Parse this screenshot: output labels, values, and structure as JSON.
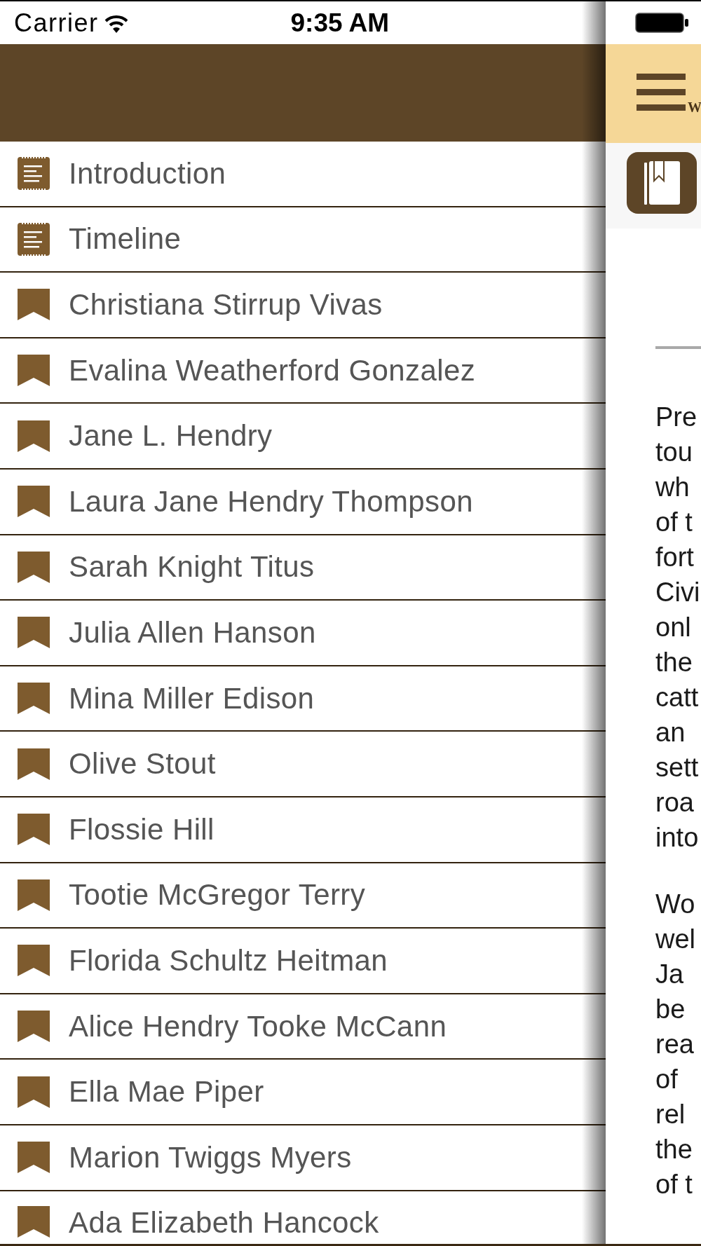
{
  "status_bar": {
    "carrier": "Carrier",
    "time": "9:35 AM"
  },
  "menu": {
    "items": [
      {
        "kind": "document",
        "label": "Introduction"
      },
      {
        "kind": "document",
        "label": "Timeline"
      },
      {
        "kind": "bookmark",
        "label": "Christiana Stirrup Vivas"
      },
      {
        "kind": "bookmark",
        "label": "Evalina Weatherford Gonzalez"
      },
      {
        "kind": "bookmark",
        "label": "Jane L. Hendry"
      },
      {
        "kind": "bookmark",
        "label": "Laura Jane Hendry Thompson"
      },
      {
        "kind": "bookmark",
        "label": "Sarah Knight Titus"
      },
      {
        "kind": "bookmark",
        "label": "Julia Allen Hanson"
      },
      {
        "kind": "bookmark",
        "label": "Mina Miller Edison"
      },
      {
        "kind": "bookmark",
        "label": "Olive Stout"
      },
      {
        "kind": "bookmark",
        "label": "Flossie Hill"
      },
      {
        "kind": "bookmark",
        "label": "Tootie McGregor Terry"
      },
      {
        "kind": "bookmark",
        "label": "Florida Schultz Heitman"
      },
      {
        "kind": "bookmark",
        "label": "Alice Hendry Tooke McCann"
      },
      {
        "kind": "bookmark",
        "label": "Ella Mae Piper"
      },
      {
        "kind": "bookmark",
        "label": "Marion Twiggs Myers"
      },
      {
        "kind": "bookmark",
        "label": "Ada Elizabeth Hancock"
      }
    ]
  },
  "reader": {
    "title": "W",
    "paragraphs": [
      {
        "lines": [
          "Pre",
          "tou",
          "wh",
          "of t",
          "fort",
          "Civi",
          "onl",
          "the",
          "catt",
          "an",
          "sett",
          "roa",
          "into"
        ]
      },
      {
        "lines": [
          "Wo",
          "wel",
          "Ja",
          "be",
          "rea",
          "of",
          "rel",
          "the",
          "of t"
        ]
      }
    ]
  }
}
